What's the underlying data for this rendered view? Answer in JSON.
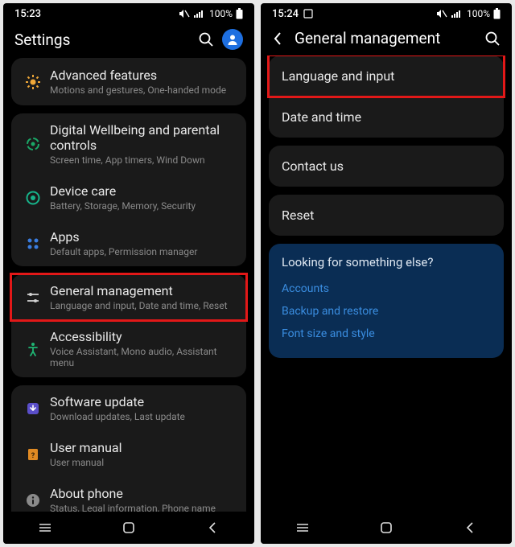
{
  "left": {
    "status": {
      "time": "15:23",
      "battery_pct": "100%"
    },
    "header": {
      "title": "Settings"
    },
    "groups": [
      {
        "items": [
          {
            "icon": "advanced-features-icon",
            "title": "Advanced features",
            "sub": "Motions and gestures, One-handed mode"
          }
        ]
      },
      {
        "items": [
          {
            "icon": "wellbeing-icon",
            "title": "Digital Wellbeing and parental controls",
            "sub": "Screen time, App timers, Wind Down"
          },
          {
            "icon": "device-care-icon",
            "title": "Device care",
            "sub": "Battery, Storage, Memory, Security"
          },
          {
            "icon": "apps-icon",
            "title": "Apps",
            "sub": "Default apps, Permission manager"
          }
        ]
      },
      {
        "items": [
          {
            "icon": "sliders-icon",
            "title": "General management",
            "sub": "Language and input, Date and time, Reset",
            "highlight": true
          },
          {
            "icon": "accessibility-icon",
            "title": "Accessibility",
            "sub": "Voice Assistant, Mono audio, Assistant menu"
          }
        ]
      },
      {
        "items": [
          {
            "icon": "update-icon",
            "title": "Software update",
            "sub": "Download updates, Last update"
          },
          {
            "icon": "manual-icon",
            "title": "User manual",
            "sub": "User manual"
          },
          {
            "icon": "info-icon",
            "title": "About phone",
            "sub": "Status, Legal information, Phone name"
          }
        ]
      }
    ]
  },
  "right": {
    "status": {
      "time": "15:24",
      "battery_pct": "100%"
    },
    "header": {
      "title": "General management"
    },
    "group1": [
      {
        "label": "Language and input",
        "highlight": true
      },
      {
        "label": "Date and time"
      }
    ],
    "group2": [
      {
        "label": "Contact us"
      }
    ],
    "group3": [
      {
        "label": "Reset"
      }
    ],
    "suggest": {
      "title": "Looking for something else?",
      "links": [
        "Accounts",
        "Backup and restore",
        "Font size and style"
      ]
    }
  }
}
